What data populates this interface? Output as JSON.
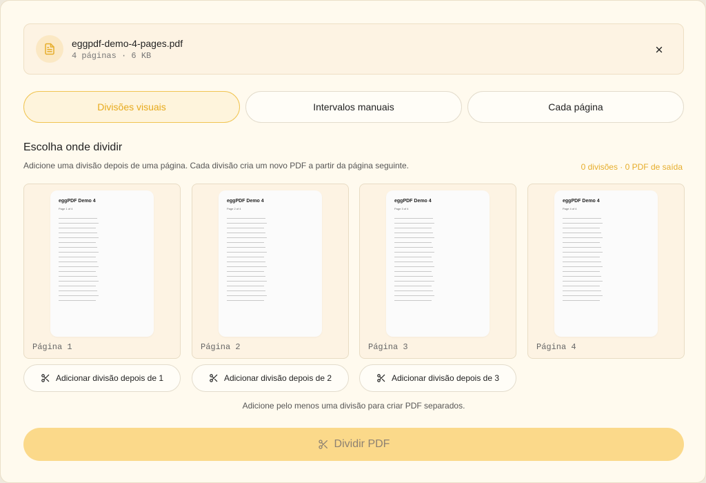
{
  "file": {
    "name": "eggpdf-demo-4-pages.pdf",
    "meta": "4 páginas · 6 KB",
    "icon": "file-text-icon",
    "close_icon": "close-icon"
  },
  "tabs": [
    {
      "label": "Divisões visuais",
      "active": true
    },
    {
      "label": "Intervalos manuais",
      "active": false
    },
    {
      "label": "Cada página",
      "active": false
    }
  ],
  "section": {
    "title": "Escolha onde dividir",
    "subtitle": "Adicione uma divisão depois de uma página. Cada divisão cria um novo PDF a partir da página seguinte.",
    "counter": "0 divisões · 0 PDF de saída"
  },
  "pages": [
    {
      "label": "Página 1",
      "thumb_title": "eggPDF Demo 4",
      "thumb_sub": "Page 1 of 4"
    },
    {
      "label": "Página 2",
      "thumb_title": "eggPDF Demo 4",
      "thumb_sub": "Page 2 of 4"
    },
    {
      "label": "Página 3",
      "thumb_title": "eggPDF Demo 4",
      "thumb_sub": "Page 3 of 4"
    },
    {
      "label": "Página 4",
      "thumb_title": "eggPDF Demo 4",
      "thumb_sub": "Page 4 of 4"
    }
  ],
  "split_buttons": [
    {
      "label": "Adicionar divisão depois de 1"
    },
    {
      "label": "Adicionar divisão depois de 2"
    },
    {
      "label": "Adicionar divisão depois de 3"
    }
  ],
  "hint": "Adicione pelo menos uma divisão para criar PDF separados.",
  "primary": {
    "label": "Dividir PDF",
    "icon": "scissors-icon"
  },
  "colors": {
    "accent": "#e7aa1c",
    "primary_disabled_bg": "#fbd98a",
    "panel_bg": "#fffaee"
  }
}
